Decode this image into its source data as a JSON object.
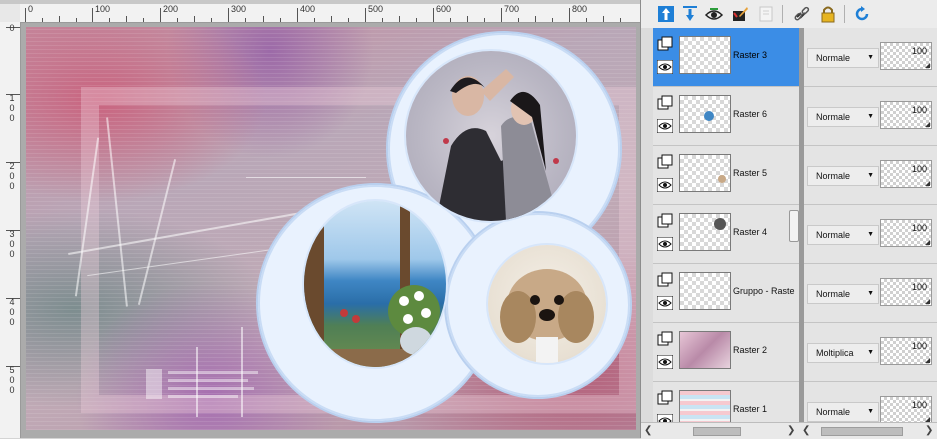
{
  "ruler": {
    "top_labels": [
      "0",
      "100",
      "200",
      "300",
      "400",
      "500",
      "600",
      "700",
      "800"
    ],
    "left_labels": [
      [
        "0"
      ],
      [
        "1",
        "0",
        "0"
      ],
      [
        "2",
        "0",
        "0"
      ],
      [
        "3",
        "0",
        "0"
      ],
      [
        "4",
        "0",
        "0"
      ],
      [
        "5",
        "0",
        "0"
      ]
    ]
  },
  "toolbar": {
    "icons": [
      "move-layer-up-icon",
      "move-layer-down-icon",
      "toggle-visibility-icon",
      "edit-selection-icon",
      "new-mask-icon",
      "link-icon",
      "lock-icon",
      "refresh-icon"
    ]
  },
  "layers": [
    {
      "name": "Raster 3",
      "selected": true,
      "blend": "Normale",
      "opacity": "100"
    },
    {
      "name": "Raster 6",
      "selected": false,
      "blend": "Normale",
      "opacity": "100"
    },
    {
      "name": "Raster 5",
      "selected": false,
      "blend": "Normale",
      "opacity": "100"
    },
    {
      "name": "Raster 4",
      "selected": false,
      "blend": "Normale",
      "opacity": "100"
    },
    {
      "name": "Gruppo - Raste",
      "selected": false,
      "blend": "Normale",
      "opacity": "100"
    },
    {
      "name": "Raster 2",
      "selected": false,
      "blend": "Moltiplica",
      "opacity": "100"
    },
    {
      "name": "Raster 1",
      "selected": false,
      "blend": "Normale",
      "opacity": "100"
    }
  ],
  "colors": {
    "selected_row": "#3b8de6",
    "ring": "#e9f2fe",
    "ring_edge": "#b9d0ef",
    "toolbar_accent": "#1e7fd6"
  }
}
